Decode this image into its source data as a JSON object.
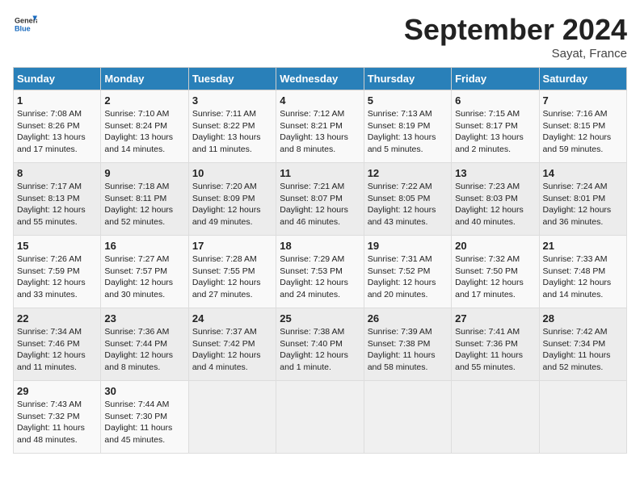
{
  "header": {
    "logo_line1": "General",
    "logo_line2": "Blue",
    "month_title": "September 2024",
    "location": "Sayat, France"
  },
  "weekdays": [
    "Sunday",
    "Monday",
    "Tuesday",
    "Wednesday",
    "Thursday",
    "Friday",
    "Saturday"
  ],
  "weeks": [
    [
      {
        "day": "1",
        "sunrise": "Sunrise: 7:08 AM",
        "sunset": "Sunset: 8:26 PM",
        "daylight": "Daylight: 13 hours and 17 minutes."
      },
      {
        "day": "2",
        "sunrise": "Sunrise: 7:10 AM",
        "sunset": "Sunset: 8:24 PM",
        "daylight": "Daylight: 13 hours and 14 minutes."
      },
      {
        "day": "3",
        "sunrise": "Sunrise: 7:11 AM",
        "sunset": "Sunset: 8:22 PM",
        "daylight": "Daylight: 13 hours and 11 minutes."
      },
      {
        "day": "4",
        "sunrise": "Sunrise: 7:12 AM",
        "sunset": "Sunset: 8:21 PM",
        "daylight": "Daylight: 13 hours and 8 minutes."
      },
      {
        "day": "5",
        "sunrise": "Sunrise: 7:13 AM",
        "sunset": "Sunset: 8:19 PM",
        "daylight": "Daylight: 13 hours and 5 minutes."
      },
      {
        "day": "6",
        "sunrise": "Sunrise: 7:15 AM",
        "sunset": "Sunset: 8:17 PM",
        "daylight": "Daylight: 13 hours and 2 minutes."
      },
      {
        "day": "7",
        "sunrise": "Sunrise: 7:16 AM",
        "sunset": "Sunset: 8:15 PM",
        "daylight": "Daylight: 12 hours and 59 minutes."
      }
    ],
    [
      {
        "day": "8",
        "sunrise": "Sunrise: 7:17 AM",
        "sunset": "Sunset: 8:13 PM",
        "daylight": "Daylight: 12 hours and 55 minutes."
      },
      {
        "day": "9",
        "sunrise": "Sunrise: 7:18 AM",
        "sunset": "Sunset: 8:11 PM",
        "daylight": "Daylight: 12 hours and 52 minutes."
      },
      {
        "day": "10",
        "sunrise": "Sunrise: 7:20 AM",
        "sunset": "Sunset: 8:09 PM",
        "daylight": "Daylight: 12 hours and 49 minutes."
      },
      {
        "day": "11",
        "sunrise": "Sunrise: 7:21 AM",
        "sunset": "Sunset: 8:07 PM",
        "daylight": "Daylight: 12 hours and 46 minutes."
      },
      {
        "day": "12",
        "sunrise": "Sunrise: 7:22 AM",
        "sunset": "Sunset: 8:05 PM",
        "daylight": "Daylight: 12 hours and 43 minutes."
      },
      {
        "day": "13",
        "sunrise": "Sunrise: 7:23 AM",
        "sunset": "Sunset: 8:03 PM",
        "daylight": "Daylight: 12 hours and 40 minutes."
      },
      {
        "day": "14",
        "sunrise": "Sunrise: 7:24 AM",
        "sunset": "Sunset: 8:01 PM",
        "daylight": "Daylight: 12 hours and 36 minutes."
      }
    ],
    [
      {
        "day": "15",
        "sunrise": "Sunrise: 7:26 AM",
        "sunset": "Sunset: 7:59 PM",
        "daylight": "Daylight: 12 hours and 33 minutes."
      },
      {
        "day": "16",
        "sunrise": "Sunrise: 7:27 AM",
        "sunset": "Sunset: 7:57 PM",
        "daylight": "Daylight: 12 hours and 30 minutes."
      },
      {
        "day": "17",
        "sunrise": "Sunrise: 7:28 AM",
        "sunset": "Sunset: 7:55 PM",
        "daylight": "Daylight: 12 hours and 27 minutes."
      },
      {
        "day": "18",
        "sunrise": "Sunrise: 7:29 AM",
        "sunset": "Sunset: 7:53 PM",
        "daylight": "Daylight: 12 hours and 24 minutes."
      },
      {
        "day": "19",
        "sunrise": "Sunrise: 7:31 AM",
        "sunset": "Sunset: 7:52 PM",
        "daylight": "Daylight: 12 hours and 20 minutes."
      },
      {
        "day": "20",
        "sunrise": "Sunrise: 7:32 AM",
        "sunset": "Sunset: 7:50 PM",
        "daylight": "Daylight: 12 hours and 17 minutes."
      },
      {
        "day": "21",
        "sunrise": "Sunrise: 7:33 AM",
        "sunset": "Sunset: 7:48 PM",
        "daylight": "Daylight: 12 hours and 14 minutes."
      }
    ],
    [
      {
        "day": "22",
        "sunrise": "Sunrise: 7:34 AM",
        "sunset": "Sunset: 7:46 PM",
        "daylight": "Daylight: 12 hours and 11 minutes."
      },
      {
        "day": "23",
        "sunrise": "Sunrise: 7:36 AM",
        "sunset": "Sunset: 7:44 PM",
        "daylight": "Daylight: 12 hours and 8 minutes."
      },
      {
        "day": "24",
        "sunrise": "Sunrise: 7:37 AM",
        "sunset": "Sunset: 7:42 PM",
        "daylight": "Daylight: 12 hours and 4 minutes."
      },
      {
        "day": "25",
        "sunrise": "Sunrise: 7:38 AM",
        "sunset": "Sunset: 7:40 PM",
        "daylight": "Daylight: 12 hours and 1 minute."
      },
      {
        "day": "26",
        "sunrise": "Sunrise: 7:39 AM",
        "sunset": "Sunset: 7:38 PM",
        "daylight": "Daylight: 11 hours and 58 minutes."
      },
      {
        "day": "27",
        "sunrise": "Sunrise: 7:41 AM",
        "sunset": "Sunset: 7:36 PM",
        "daylight": "Daylight: 11 hours and 55 minutes."
      },
      {
        "day": "28",
        "sunrise": "Sunrise: 7:42 AM",
        "sunset": "Sunset: 7:34 PM",
        "daylight": "Daylight: 11 hours and 52 minutes."
      }
    ],
    [
      {
        "day": "29",
        "sunrise": "Sunrise: 7:43 AM",
        "sunset": "Sunset: 7:32 PM",
        "daylight": "Daylight: 11 hours and 48 minutes."
      },
      {
        "day": "30",
        "sunrise": "Sunrise: 7:44 AM",
        "sunset": "Sunset: 7:30 PM",
        "daylight": "Daylight: 11 hours and 45 minutes."
      },
      null,
      null,
      null,
      null,
      null
    ]
  ]
}
